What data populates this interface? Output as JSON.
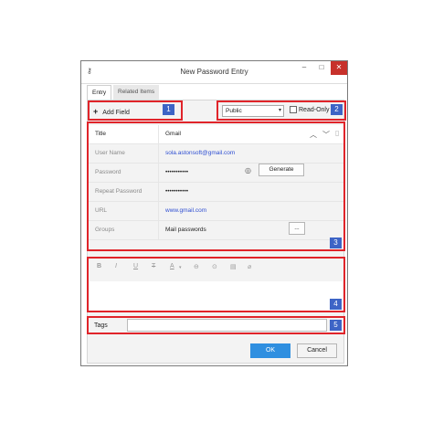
{
  "window": {
    "title": "New Password Entry",
    "title_icon": "key-icon",
    "controls": {
      "minimize": "‒",
      "maximize": "□",
      "close": "✕"
    }
  },
  "tabs": [
    "Entry",
    "Related Items"
  ],
  "toolbar": {
    "add_field_icon": "+",
    "add_field_label": "Add Field",
    "visibility_value": "Public",
    "read_only_label": "Read-Only"
  },
  "fields": [
    {
      "label": "Title",
      "value": "Gmail"
    },
    {
      "label": "User Name",
      "value": "sola.astonsoft@gmail.com"
    },
    {
      "label": "Password",
      "value": "•••••••••••",
      "button": "Generate"
    },
    {
      "label": "Repeat Password",
      "value": "•••••••••••"
    },
    {
      "label": "URL",
      "value": "www.gmail.com"
    },
    {
      "label": "Groups",
      "value": "Mail passwords",
      "button": "..."
    }
  ],
  "editor_toolbar": [
    "B",
    "I",
    "U",
    "T",
    "A",
    "⊖",
    "⊙",
    "▤",
    "⌀"
  ],
  "tags": {
    "label": "Tags",
    "value": ""
  },
  "buttons": {
    "ok": "OK",
    "cancel": "Cancel"
  },
  "badges": [
    "1",
    "2",
    "3",
    "4",
    "5"
  ],
  "colors": {
    "callout": "#e0242a",
    "badge": "#3d64c6",
    "ok_button": "#2f8fe0",
    "link": "#2f4fd2",
    "close_button": "#c7312b"
  }
}
